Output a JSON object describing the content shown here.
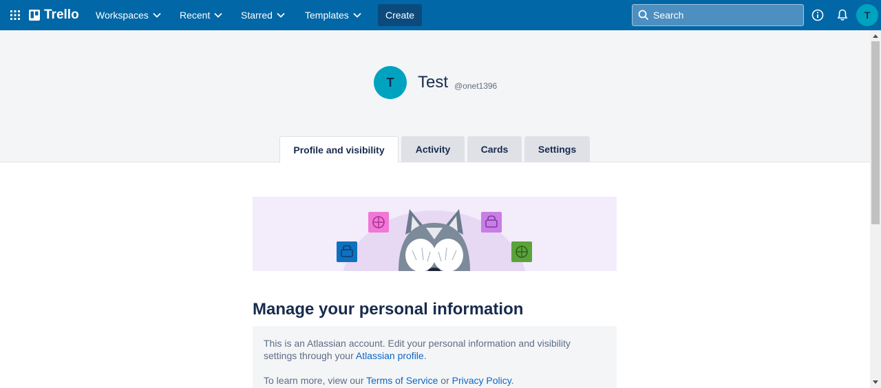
{
  "header": {
    "logo_text": "Trello",
    "nav": {
      "workspaces": "Workspaces",
      "recent": "Recent",
      "starred": "Starred",
      "templates": "Templates"
    },
    "create_label": "Create",
    "search_placeholder": "Search",
    "user_initial": "T",
    "bg_color": "#0267a6"
  },
  "profile": {
    "initial": "T",
    "full_name": "Test",
    "username": "@onet1396"
  },
  "tabs": [
    {
      "label": "Profile and visibility",
      "active": true
    },
    {
      "label": "Activity",
      "active": false
    },
    {
      "label": "Cards",
      "active": false
    },
    {
      "label": "Settings",
      "active": false
    }
  ],
  "main": {
    "heading": "Manage your personal information",
    "info_line1": "This is an Atlassian account. Edit your personal information and visibility settings through your ",
    "atlassian_profile_link": "Atlassian profile",
    "info_line1_end": ".",
    "info_line2": "To learn more, view our ",
    "terms_link": "Terms of Service",
    "or_text": " or ",
    "privacy_link": "Privacy Policy",
    "info_line2_end": "."
  }
}
